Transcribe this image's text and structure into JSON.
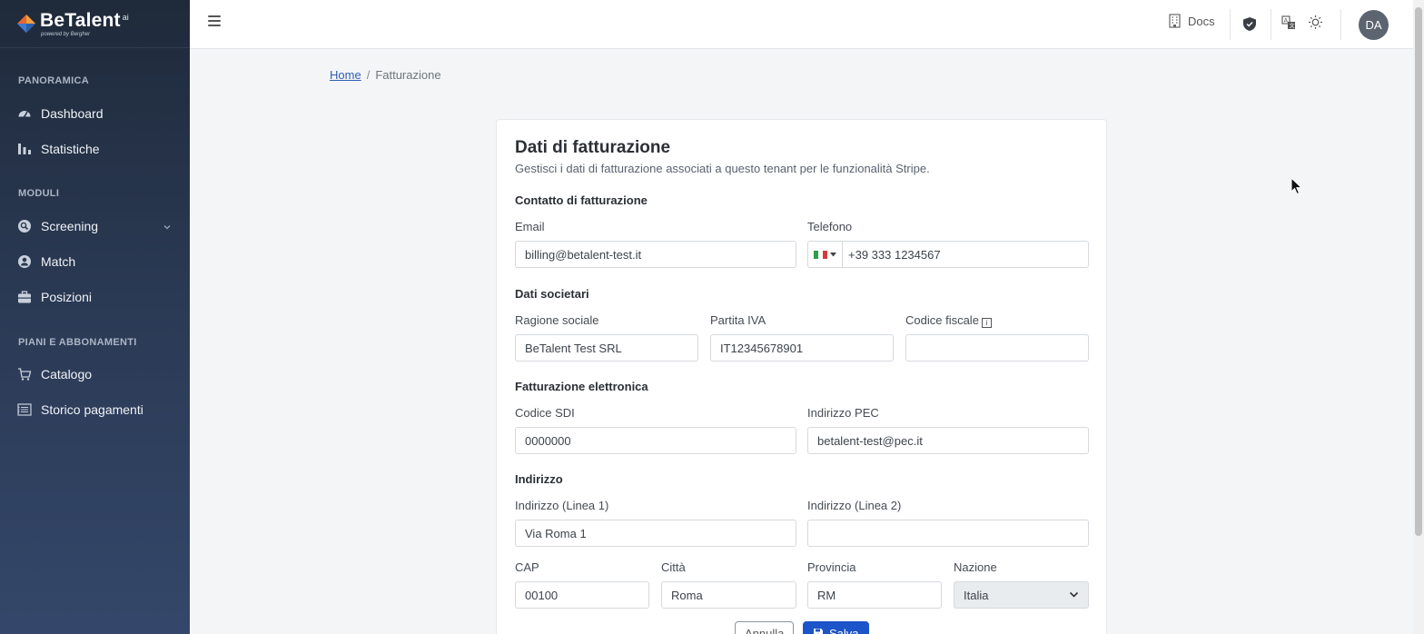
{
  "brand": {
    "name": "BeTalent",
    "ai": "ai",
    "tagline": "powered by Bergher"
  },
  "sidebar": {
    "sections": [
      {
        "label": "PANORAMICA"
      },
      {
        "label": "MODULI"
      },
      {
        "label": "PIANI E ABBONAMENTI"
      }
    ],
    "items": [
      {
        "label": "Dashboard",
        "icon": "gauge-icon"
      },
      {
        "label": "Statistiche",
        "icon": "bar-chart-icon"
      },
      {
        "label": "Screening",
        "icon": "search-doc-icon"
      },
      {
        "label": "Match",
        "icon": "user-badge-icon"
      },
      {
        "label": "Posizioni",
        "icon": "briefcase-icon"
      },
      {
        "label": "Catalogo",
        "icon": "cart-icon"
      },
      {
        "label": "Storico pagamenti",
        "icon": "receipt-icon"
      }
    ]
  },
  "topbar": {
    "docs_label": "Docs",
    "avatar_initials": "DA"
  },
  "breadcrumb": {
    "home": "Home",
    "separator": "/",
    "current": "Fatturazione"
  },
  "form": {
    "title": "Dati di fatturazione",
    "subtitle": "Gestisci i dati di fatturazione associati a questo tenant per le funzionalità Stripe.",
    "sections": {
      "contact": "Contatto di fatturazione",
      "company": "Dati societari",
      "einvoice": "Fatturazione elettronica",
      "address": "Indirizzo"
    },
    "fields": {
      "email": {
        "label": "Email",
        "value": "billing@betalent-test.it"
      },
      "phone": {
        "label": "Telefono",
        "value": "+39 333 1234567"
      },
      "ragione": {
        "label": "Ragione sociale",
        "value": "BeTalent Test SRL"
      },
      "piva": {
        "label": "Partita IVA",
        "value": "IT12345678901"
      },
      "cf": {
        "label": "Codice fiscale",
        "value": ""
      },
      "sdi": {
        "label": "Codice SDI",
        "value": "0000000"
      },
      "pec": {
        "label": "Indirizzo PEC",
        "value": "betalent-test@pec.it"
      },
      "addr1": {
        "label": "Indirizzo (Linea 1)",
        "value": "Via Roma 1"
      },
      "addr2": {
        "label": "Indirizzo (Linea 2)",
        "value": ""
      },
      "cap": {
        "label": "CAP",
        "value": "00100"
      },
      "citta": {
        "label": "Città",
        "value": "Roma"
      },
      "provincia": {
        "label": "Provincia",
        "value": "RM"
      },
      "nazione": {
        "label": "Nazione",
        "value": "Italia"
      }
    },
    "buttons": {
      "cancel": "Annulla",
      "save": "Salva"
    }
  },
  "colors": {
    "primary": "#1c54c9",
    "sidebar_top": "#1f2a3a",
    "sidebar_bottom": "#34476a"
  }
}
